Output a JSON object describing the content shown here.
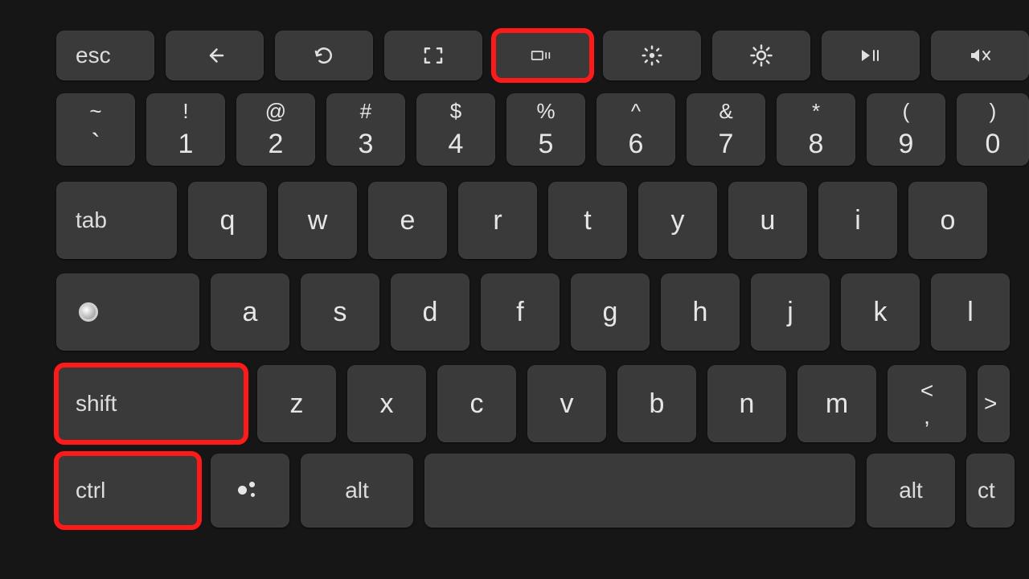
{
  "func_row": {
    "esc": "esc",
    "keys": [
      "back",
      "refresh",
      "fullscreen",
      "overview",
      "brightness-down",
      "brightness-up",
      "play-pause",
      "mute"
    ],
    "highlighted": "overview"
  },
  "number_row": [
    {
      "top": "~",
      "bot": "`"
    },
    {
      "top": "!",
      "bot": "1"
    },
    {
      "top": "@",
      "bot": "2"
    },
    {
      "top": "#",
      "bot": "3"
    },
    {
      "top": "$",
      "bot": "4"
    },
    {
      "top": "%",
      "bot": "5"
    },
    {
      "top": "^",
      "bot": "6"
    },
    {
      "top": "&",
      "bot": "7"
    },
    {
      "top": "*",
      "bot": "8"
    },
    {
      "top": "(",
      "bot": "9"
    },
    {
      "top": ")",
      "bot": "0"
    }
  ],
  "qwerty_row": {
    "tab": "tab",
    "letters": [
      "q",
      "w",
      "e",
      "r",
      "t",
      "y",
      "u",
      "i",
      "o"
    ]
  },
  "home_row": {
    "caps_key": "search",
    "letters": [
      "a",
      "s",
      "d",
      "f",
      "g",
      "h",
      "j",
      "k",
      "l"
    ]
  },
  "shift_row": {
    "shift": "shift",
    "letters": [
      "z",
      "x",
      "c",
      "v",
      "b",
      "n",
      "m"
    ],
    "comma_top": "<",
    "comma_bot": ",",
    "gt": ">",
    "highlighted": "shift"
  },
  "control_row": {
    "ctrl": "ctrl",
    "assistant": "assistant",
    "alt_left": "alt",
    "space": "",
    "alt_right": "alt",
    "ctrl_right": "ct",
    "highlighted": "ctrl"
  }
}
